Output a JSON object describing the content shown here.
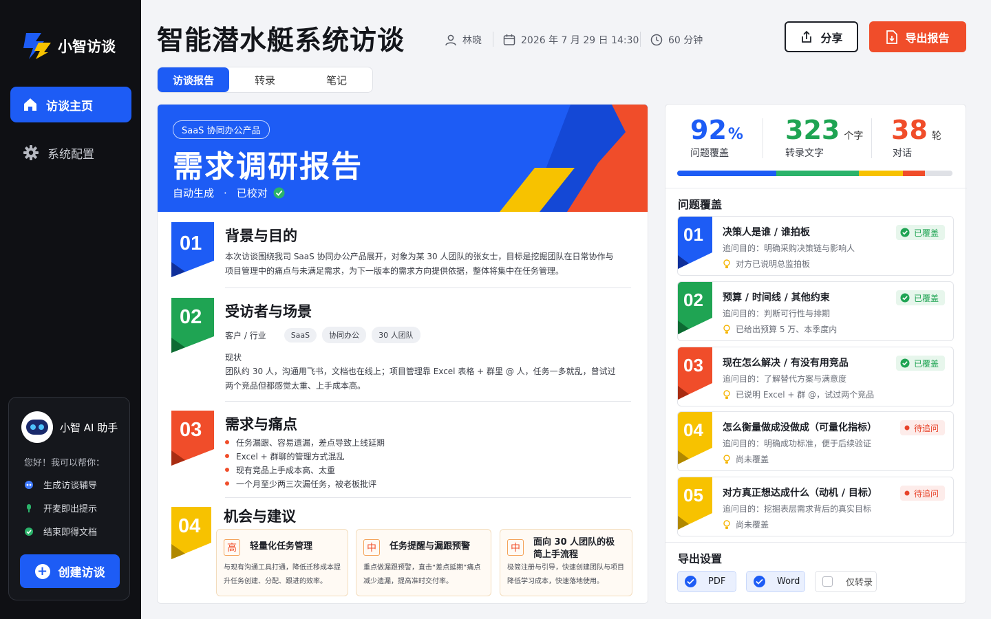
{
  "app": {
    "name": "小智访谈"
  },
  "sidebar": {
    "items": [
      {
        "label": "访谈主页",
        "icon": "home-icon"
      },
      {
        "label": "系统配置",
        "icon": "gear-icon"
      }
    ]
  },
  "assistant": {
    "name": "小智 AI 助手",
    "greeting": "您好！我可以帮你：",
    "items": [
      "生成访谈辅导",
      "开麦即出提示",
      "结束即得文档"
    ],
    "create_label": "创建访谈"
  },
  "header": {
    "title": "智能潜水艇系统访谈",
    "interviewer": "林晓",
    "datetime": "2026 年 7 月 29 日 14:30",
    "duration": "60 分钟",
    "share_label": "分享",
    "export_label": "导出报告"
  },
  "tabs": [
    {
      "label": "访谈报告",
      "active": true
    },
    {
      "label": "转录",
      "active": false
    },
    {
      "label": "笔记",
      "active": false
    }
  ],
  "report": {
    "tag": "SaaS 协同办公产品",
    "title": "需求调研报告",
    "sub_auto": "自动生成",
    "sub_dot": "·",
    "sub_checked": "已校对",
    "sections": [
      {
        "num": "01",
        "title": "背景与目的",
        "text": "本次访谈围绕我司 SaaS 协同办公产品展开，对象为某 30 人团队的张女士，目标是挖掘团队在日常协作与项目管理中的痛点与未满足需求，为下一版本的需求方向提供依据，整体将集中在任务管理。"
      },
      {
        "num": "02",
        "title": "受访者与场景",
        "client_label": "客户 / 行业",
        "chips": [
          "SaaS",
          "协同办公",
          "30 人团队"
        ],
        "status_label": "现状",
        "text": "团队约 30 人，沟通用飞书，文档也在线上；项目管理靠 Excel 表格 + 群里 @ 人，任务一多就乱，曾试过两个竞品但都感觉太重、上手成本高。"
      },
      {
        "num": "03",
        "title": "需求与痛点",
        "bullets": [
          "任务漏跟、容易遗漏，差点导致上线延期",
          "Excel + 群聊的管理方式混乱",
          "现有竞品上手成本高、太重",
          "一个月至少两三次漏任务，被老板批评"
        ]
      },
      {
        "num": "04",
        "title": "机会与建议",
        "opportunities": [
          {
            "level": "高",
            "title": "轻量化任务管理",
            "desc": "与现有沟通工具打通，降低迁移成本提升任务创建、分配、跟进的效率。"
          },
          {
            "level": "中",
            "title": "任务提醒与漏跟预警",
            "desc": "重点做漏跟预警，直击“差点延期”痛点减少遗漏，提高准时交付率。"
          },
          {
            "level": "中",
            "title": "面向 30 人团队的极简上手流程",
            "desc": "极简注册与引导，快速创建团队与项目降低学习成本，快速落地使用。"
          }
        ]
      }
    ]
  },
  "stats": [
    {
      "value": "92",
      "unit": "%",
      "label": "问题覆盖",
      "color": "#1d5cf5"
    },
    {
      "value": "323",
      "unit": "个字",
      "label": "转录文字",
      "color": "#1fa453"
    },
    {
      "value": "38",
      "unit": "轮",
      "label": "对话",
      "color": "#f04d2a"
    }
  ],
  "coverage_progress": {
    "segments": [
      {
        "fraction": 0.36,
        "color": "#1d5cf5"
      },
      {
        "fraction": 0.3,
        "color": "#2bb36a"
      },
      {
        "fraction": 0.16,
        "color": "#f7c200"
      },
      {
        "fraction": 0.08,
        "color": "#f04d2a"
      },
      {
        "fraction": 0.1,
        "color": "#dfe1e6"
      }
    ]
  },
  "coverage": {
    "title": "问题覆盖",
    "questions": [
      {
        "num": "01",
        "title": "决策人是谁 / 谁拍板",
        "purpose": "追问目的：明确采购决策链与影响人",
        "note": "对方已说明总监拍板",
        "status": "已覆盖",
        "covered": true,
        "color": "#1d5cf5"
      },
      {
        "num": "02",
        "title": "预算 / 时间线 / 其他约束",
        "purpose": "追问目的：判断可行性与排期",
        "note": "已给出预算 5 万、本季度内",
        "status": "已覆盖",
        "covered": true,
        "color": "#1fa453"
      },
      {
        "num": "03",
        "title": "现在怎么解决 / 有没有用竞品",
        "purpose": "追问目的：了解替代方案与满意度",
        "note": "已说明 Excel + 群 @，试过两个竞品",
        "status": "已覆盖",
        "covered": true,
        "color": "#f04d2a"
      },
      {
        "num": "04",
        "title": "怎么衡量做成没做成（可量化指标）",
        "purpose": "追问目的：明确成功标准，便于后续验证",
        "note": "尚未覆盖",
        "status": "待追问",
        "covered": false,
        "color": "#f7c200"
      },
      {
        "num": "05",
        "title": "对方真正想达成什么（动机 / 目标）",
        "purpose": "追问目的：挖掘表层需求背后的真实目标",
        "note": "尚未覆盖",
        "status": "待追问",
        "covered": false,
        "color": "#f7c200"
      }
    ]
  },
  "export": {
    "title": "导出设置",
    "options": [
      {
        "label": "PDF",
        "checked": true
      },
      {
        "label": "Word",
        "checked": true
      },
      {
        "label": "仅转录",
        "checked": false
      }
    ]
  }
}
